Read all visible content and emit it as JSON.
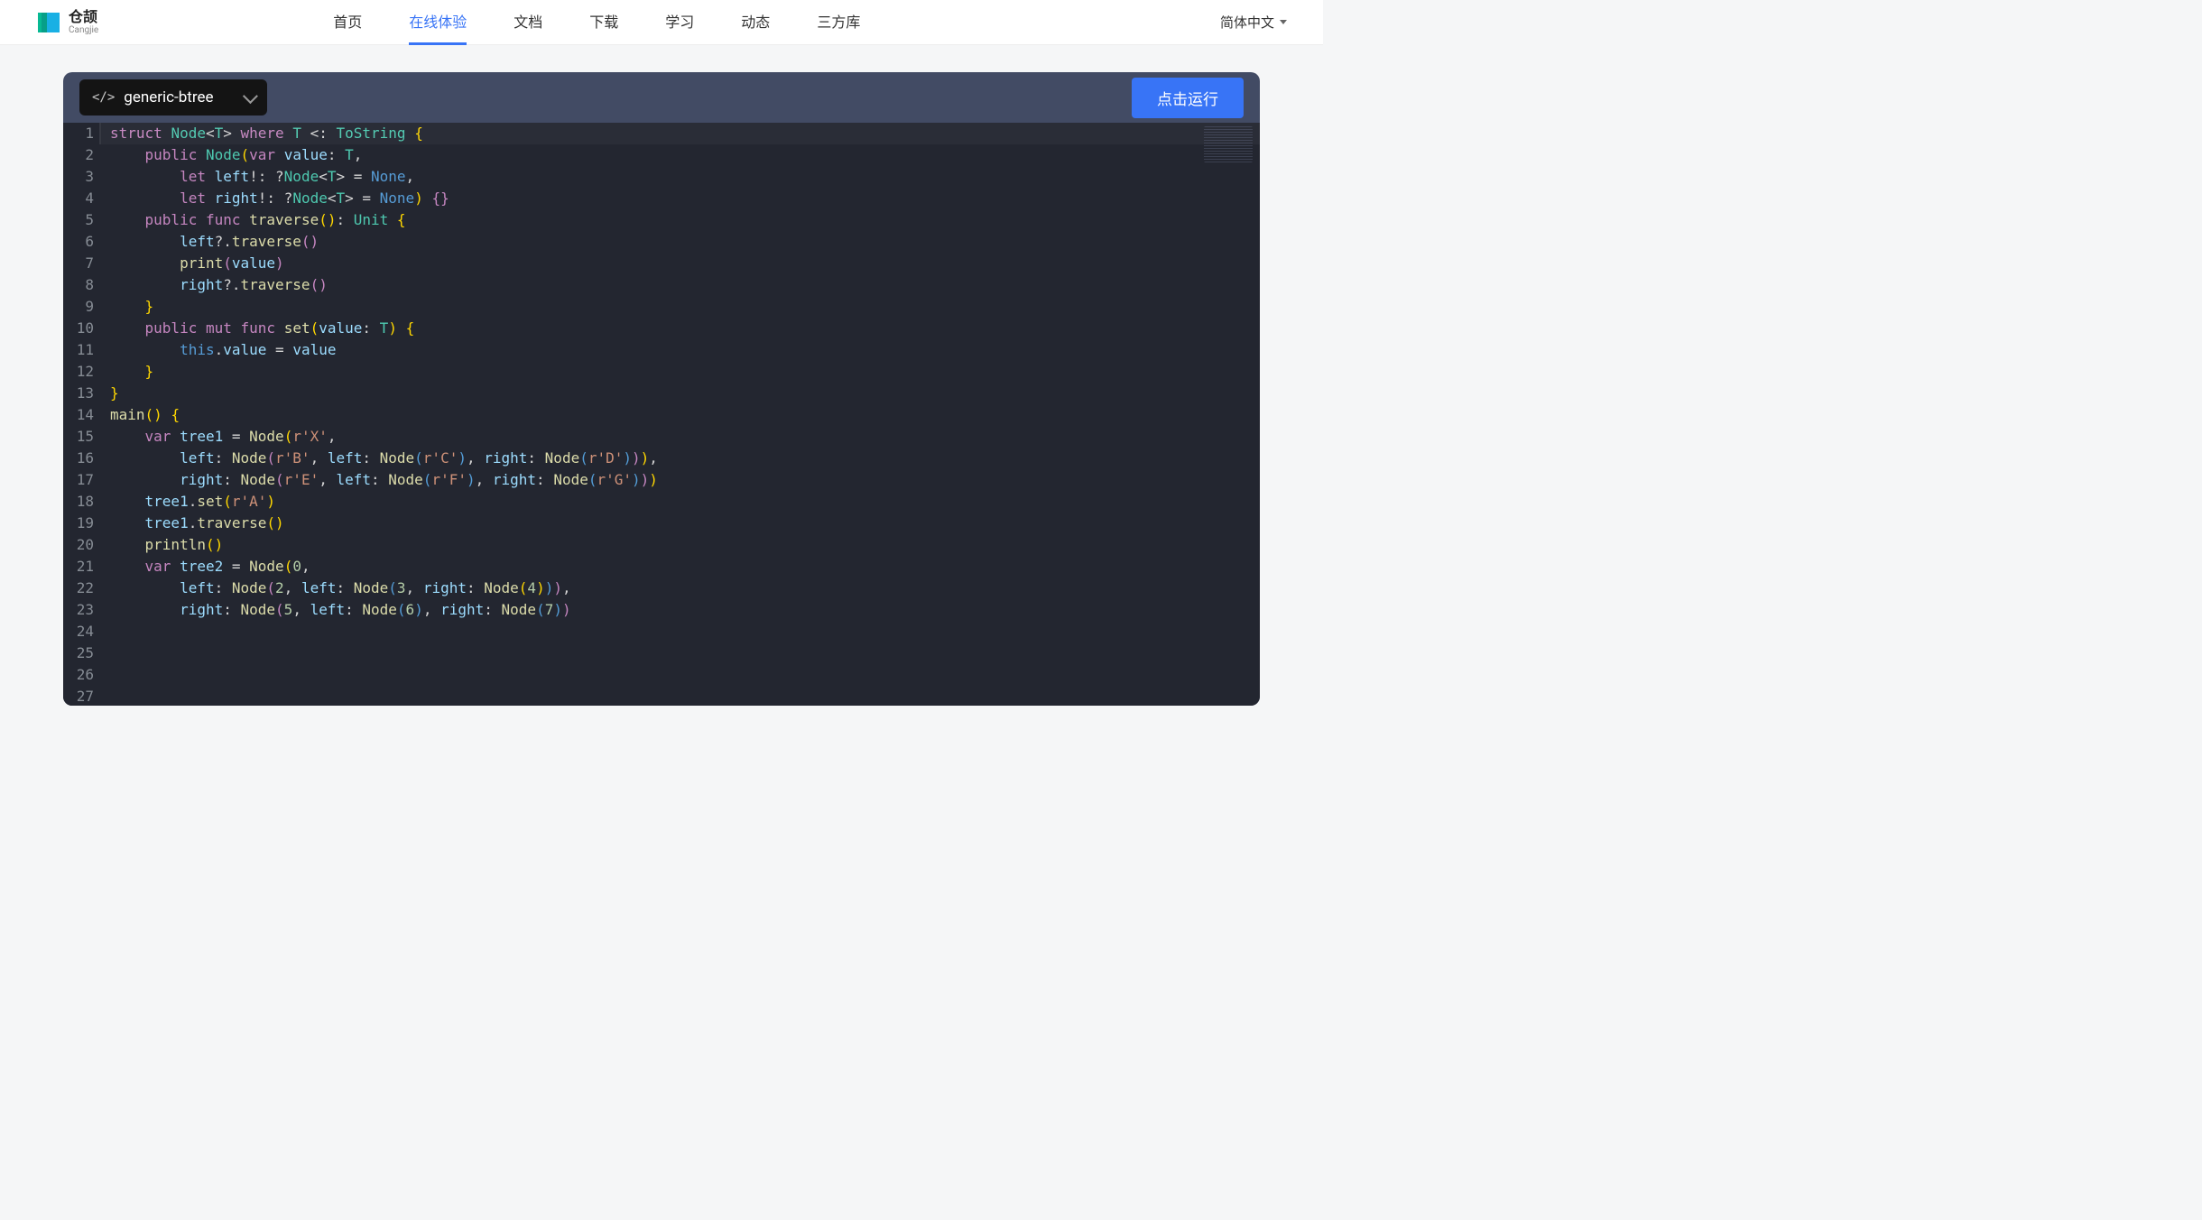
{
  "logo": {
    "cn": "仓颉",
    "en": "Cangjie"
  },
  "nav": {
    "items": [
      "首页",
      "在线体验",
      "文档",
      "下载",
      "学习",
      "动态",
      "三方库"
    ],
    "active_index": 1
  },
  "lang_label": "简体中文",
  "toolbar": {
    "file_label": "generic-btree",
    "run_label": "点击运行"
  },
  "code_lines": [
    {
      "n": 1,
      "t": [
        [
          "kw",
          "struct"
        ],
        [
          "p",
          " "
        ],
        [
          "ty",
          "Node"
        ],
        [
          "p",
          "<"
        ],
        [
          "ty",
          "T"
        ],
        [
          "p",
          "> "
        ],
        [
          "kw",
          "where"
        ],
        [
          "p",
          " "
        ],
        [
          "ty",
          "T"
        ],
        [
          "p",
          " <: "
        ],
        [
          "ty",
          "ToString"
        ],
        [
          "p",
          " "
        ],
        [
          "py",
          "{"
        ]
      ]
    },
    {
      "n": 2,
      "t": [
        [
          "p",
          "    "
        ],
        [
          "kw",
          "public"
        ],
        [
          "p",
          " "
        ],
        [
          "ty",
          "Node"
        ],
        [
          "py",
          "("
        ],
        [
          "kw",
          "var"
        ],
        [
          "p",
          " "
        ],
        [
          "id",
          "value"
        ],
        [
          "p",
          ": "
        ],
        [
          "ty",
          "T"
        ],
        [
          "p",
          ","
        ]
      ]
    },
    {
      "n": 3,
      "t": [
        [
          "p",
          "        "
        ],
        [
          "kw",
          "let"
        ],
        [
          "p",
          " "
        ],
        [
          "id",
          "left"
        ],
        [
          "p",
          "!: ?"
        ],
        [
          "ty",
          "Node"
        ],
        [
          "p",
          "<"
        ],
        [
          "ty",
          "T"
        ],
        [
          "p",
          "> = "
        ],
        [
          "none",
          "None"
        ],
        [
          "p",
          ","
        ]
      ]
    },
    {
      "n": 4,
      "t": [
        [
          "p",
          "        "
        ],
        [
          "kw",
          "let"
        ],
        [
          "p",
          " "
        ],
        [
          "id",
          "right"
        ],
        [
          "p",
          "!: ?"
        ],
        [
          "ty",
          "Node"
        ],
        [
          "p",
          "<"
        ],
        [
          "ty",
          "T"
        ],
        [
          "p",
          "> = "
        ],
        [
          "none",
          "None"
        ],
        [
          "py",
          ")"
        ],
        [
          "p",
          " "
        ],
        [
          "pp",
          "{}"
        ]
      ]
    },
    {
      "n": 5,
      "t": [
        [
          "p",
          ""
        ]
      ]
    },
    {
      "n": 6,
      "t": [
        [
          "p",
          "    "
        ],
        [
          "kw",
          "public"
        ],
        [
          "p",
          " "
        ],
        [
          "kw",
          "func"
        ],
        [
          "p",
          " "
        ],
        [
          "fn",
          "traverse"
        ],
        [
          "py",
          "()"
        ],
        [
          "p",
          ": "
        ],
        [
          "ty",
          "Unit"
        ],
        [
          "p",
          " "
        ],
        [
          "py",
          "{"
        ]
      ]
    },
    {
      "n": 7,
      "t": [
        [
          "p",
          "        "
        ],
        [
          "id",
          "left"
        ],
        [
          "p",
          "?."
        ],
        [
          "fn",
          "traverse"
        ],
        [
          "pp",
          "()"
        ]
      ]
    },
    {
      "n": 8,
      "t": [
        [
          "p",
          "        "
        ],
        [
          "fn",
          "print"
        ],
        [
          "pp",
          "("
        ],
        [
          "id",
          "value"
        ],
        [
          "pp",
          ")"
        ]
      ]
    },
    {
      "n": 9,
      "t": [
        [
          "p",
          "        "
        ],
        [
          "id",
          "right"
        ],
        [
          "p",
          "?."
        ],
        [
          "fn",
          "traverse"
        ],
        [
          "pp",
          "()"
        ]
      ]
    },
    {
      "n": 10,
      "t": [
        [
          "p",
          "    "
        ],
        [
          "py",
          "}"
        ]
      ]
    },
    {
      "n": 11,
      "t": [
        [
          "p",
          ""
        ]
      ]
    },
    {
      "n": 12,
      "t": [
        [
          "p",
          "    "
        ],
        [
          "kw",
          "public"
        ],
        [
          "p",
          " "
        ],
        [
          "kw",
          "mut"
        ],
        [
          "p",
          " "
        ],
        [
          "kw",
          "func"
        ],
        [
          "p",
          " "
        ],
        [
          "fn",
          "set"
        ],
        [
          "py",
          "("
        ],
        [
          "id",
          "value"
        ],
        [
          "p",
          ": "
        ],
        [
          "ty",
          "T"
        ],
        [
          "py",
          ")"
        ],
        [
          "p",
          " "
        ],
        [
          "py",
          "{"
        ]
      ]
    },
    {
      "n": 13,
      "t": [
        [
          "p",
          "        "
        ],
        [
          "this",
          "this"
        ],
        [
          "p",
          "."
        ],
        [
          "id",
          "value"
        ],
        [
          "p",
          " = "
        ],
        [
          "id",
          "value"
        ]
      ]
    },
    {
      "n": 14,
      "t": [
        [
          "p",
          "    "
        ],
        [
          "py",
          "}"
        ]
      ]
    },
    {
      "n": 15,
      "t": [
        [
          "py",
          "}"
        ]
      ]
    },
    {
      "n": 16,
      "t": [
        [
          "p",
          ""
        ]
      ]
    },
    {
      "n": 17,
      "t": [
        [
          "fn",
          "main"
        ],
        [
          "py",
          "()"
        ],
        [
          "p",
          " "
        ],
        [
          "py",
          "{"
        ]
      ]
    },
    {
      "n": 18,
      "t": [
        [
          "p",
          "    "
        ],
        [
          "kw",
          "var"
        ],
        [
          "p",
          " "
        ],
        [
          "id",
          "tree1"
        ],
        [
          "p",
          " = "
        ],
        [
          "fn",
          "Node"
        ],
        [
          "py",
          "("
        ],
        [
          "str",
          "r'X'"
        ],
        [
          "p",
          ","
        ]
      ]
    },
    {
      "n": 19,
      "t": [
        [
          "p",
          "        "
        ],
        [
          "id",
          "left"
        ],
        [
          "p",
          ": "
        ],
        [
          "fn",
          "Node"
        ],
        [
          "pp",
          "("
        ],
        [
          "str",
          "r'B'"
        ],
        [
          "p",
          ", "
        ],
        [
          "id",
          "left"
        ],
        [
          "p",
          ": "
        ],
        [
          "fn",
          "Node"
        ],
        [
          "pb",
          "("
        ],
        [
          "str",
          "r'C'"
        ],
        [
          "pb",
          ")"
        ],
        [
          "p",
          ", "
        ],
        [
          "id",
          "right"
        ],
        [
          "p",
          ": "
        ],
        [
          "fn",
          "Node"
        ],
        [
          "pb",
          "("
        ],
        [
          "str",
          "r'D'"
        ],
        [
          "pb",
          ")"
        ],
        [
          "pp",
          ")"
        ],
        [
          "py",
          ")"
        ],
        [
          "p",
          ","
        ]
      ]
    },
    {
      "n": 20,
      "t": [
        [
          "p",
          "        "
        ],
        [
          "id",
          "right"
        ],
        [
          "p",
          ": "
        ],
        [
          "fn",
          "Node"
        ],
        [
          "pp",
          "("
        ],
        [
          "str",
          "r'E'"
        ],
        [
          "p",
          ", "
        ],
        [
          "id",
          "left"
        ],
        [
          "p",
          ": "
        ],
        [
          "fn",
          "Node"
        ],
        [
          "pb",
          "("
        ],
        [
          "str",
          "r'F'"
        ],
        [
          "pb",
          ")"
        ],
        [
          "p",
          ", "
        ],
        [
          "id",
          "right"
        ],
        [
          "p",
          ": "
        ],
        [
          "fn",
          "Node"
        ],
        [
          "pb",
          "("
        ],
        [
          "str",
          "r'G'"
        ],
        [
          "pb",
          ")"
        ],
        [
          "pp",
          ")"
        ],
        [
          "py",
          ")"
        ]
      ]
    },
    {
      "n": 21,
      "t": [
        [
          "p",
          "    "
        ],
        [
          "id",
          "tree1"
        ],
        [
          "p",
          "."
        ],
        [
          "fn",
          "set"
        ],
        [
          "py",
          "("
        ],
        [
          "str",
          "r'A'"
        ],
        [
          "py",
          ")"
        ]
      ]
    },
    {
      "n": 22,
      "t": [
        [
          "p",
          "    "
        ],
        [
          "id",
          "tree1"
        ],
        [
          "p",
          "."
        ],
        [
          "fn",
          "traverse"
        ],
        [
          "py",
          "()"
        ]
      ]
    },
    {
      "n": 23,
      "t": [
        [
          "p",
          ""
        ]
      ]
    },
    {
      "n": 24,
      "t": [
        [
          "p",
          "    "
        ],
        [
          "fn",
          "println"
        ],
        [
          "py",
          "()"
        ]
      ]
    },
    {
      "n": 25,
      "t": [
        [
          "p",
          "    "
        ],
        [
          "kw",
          "var"
        ],
        [
          "p",
          " "
        ],
        [
          "id",
          "tree2"
        ],
        [
          "p",
          " = "
        ],
        [
          "fn",
          "Node"
        ],
        [
          "py",
          "("
        ],
        [
          "num",
          "0"
        ],
        [
          "p",
          ","
        ]
      ]
    },
    {
      "n": 26,
      "t": [
        [
          "p",
          "        "
        ],
        [
          "id",
          "left"
        ],
        [
          "p",
          ": "
        ],
        [
          "fn",
          "Node"
        ],
        [
          "pp",
          "("
        ],
        [
          "num",
          "2"
        ],
        [
          "p",
          ", "
        ],
        [
          "id",
          "left"
        ],
        [
          "p",
          ": "
        ],
        [
          "fn",
          "Node"
        ],
        [
          "pb",
          "("
        ],
        [
          "num",
          "3"
        ],
        [
          "p",
          ", "
        ],
        [
          "id",
          "right"
        ],
        [
          "p",
          ": "
        ],
        [
          "fn",
          "Node"
        ],
        [
          "py",
          "("
        ],
        [
          "num",
          "4"
        ],
        [
          "py",
          ")"
        ],
        [
          "pb",
          ")"
        ],
        [
          "pp",
          ")"
        ],
        [
          "p",
          ","
        ]
      ]
    },
    {
      "n": 27,
      "t": [
        [
          "p",
          "        "
        ],
        [
          "id",
          "right"
        ],
        [
          "p",
          ": "
        ],
        [
          "fn",
          "Node"
        ],
        [
          "pp",
          "("
        ],
        [
          "num",
          "5"
        ],
        [
          "p",
          ", "
        ],
        [
          "id",
          "left"
        ],
        [
          "p",
          ": "
        ],
        [
          "fn",
          "Node"
        ],
        [
          "pb",
          "("
        ],
        [
          "num",
          "6"
        ],
        [
          "pb",
          ")"
        ],
        [
          "p",
          ", "
        ],
        [
          "id",
          "right"
        ],
        [
          "p",
          ": "
        ],
        [
          "fn",
          "Node"
        ],
        [
          "pb",
          "("
        ],
        [
          "num",
          "7"
        ],
        [
          "pb",
          ")"
        ],
        [
          "pp",
          ")"
        ]
      ]
    }
  ]
}
